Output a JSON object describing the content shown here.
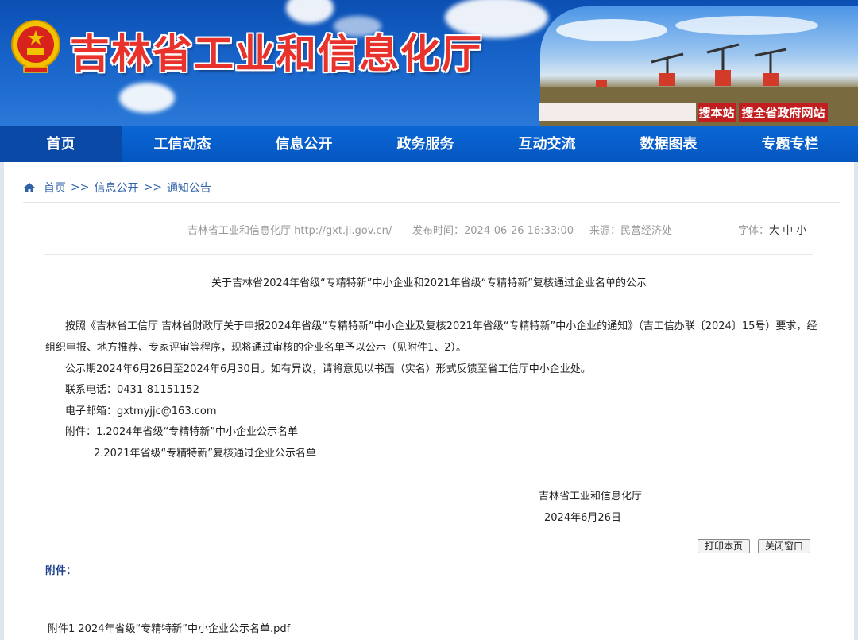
{
  "header": {
    "site_title": "吉林省工业和信息化厅",
    "search_site_label": "搜本站",
    "search_gov_label": "搜全省政府网站",
    "search_placeholder": ""
  },
  "nav": {
    "items": [
      {
        "label": "首页",
        "active": true
      },
      {
        "label": "工信动态"
      },
      {
        "label": "信息公开"
      },
      {
        "label": "政务服务"
      },
      {
        "label": "互动交流"
      },
      {
        "label": "数据图表"
      },
      {
        "label": "专题专栏"
      }
    ]
  },
  "breadcrumb": {
    "home": "首页",
    "sep": ">>",
    "level1": "信息公开",
    "level2": "通知公告"
  },
  "meta": {
    "site": "吉林省工业和信息化厅 http://gxt.jl.gov.cn/",
    "publish_time": "发布时间：2024-06-26 16:33:00",
    "source": "来源：民营经济处",
    "font_label": "字体：",
    "font_large": "大",
    "font_medium": "中",
    "font_small": "小"
  },
  "article": {
    "title": "关于吉林省2024年省级“专精特新”中小企业和2021年省级“专精特新”复核通过企业名单的公示",
    "para1_line1": "按照《吉林省工信厅 吉林省财政厅关于申报2024年省级“专精特新”中小企业及复核2021年省级“专精特新”中小企业的通知》（吉工信办联〔2024〕15号）要求，经",
    "para1_line2": "组织申报、地方推荐、专家评审等程序，现将通过审核的企业名单予以公示（见附件1、2）。",
    "para2": "公示期2024年6月26日至2024年6月30日。如有异议，请将意见以书面（实名）形式反馈至省工信厅中小企业处。",
    "phone": "联系电话：0431-81151152",
    "email": "电子邮箱：gxtmyjjc@163.com",
    "attach_line1": "附件：1.2024年省级“专精特新”中小企业公示名单",
    "attach_line2": "2.2021年省级“专精特新”复核通过企业公示名单",
    "signature_org": "吉林省工业和信息化厅",
    "signature_date": "2024年6月26日"
  },
  "actions": {
    "print": "打印本页",
    "close": "关闭窗口"
  },
  "attachments": {
    "label": "附件：",
    "files": [
      "附件1 2024年省级“专精特新”中小企业公示名单.pdf"
    ]
  },
  "colors": {
    "nav_blue": "#0556bf",
    "title_red": "#e8322b",
    "search_red": "#c11f1f",
    "link_blue": "#2f63a8"
  }
}
